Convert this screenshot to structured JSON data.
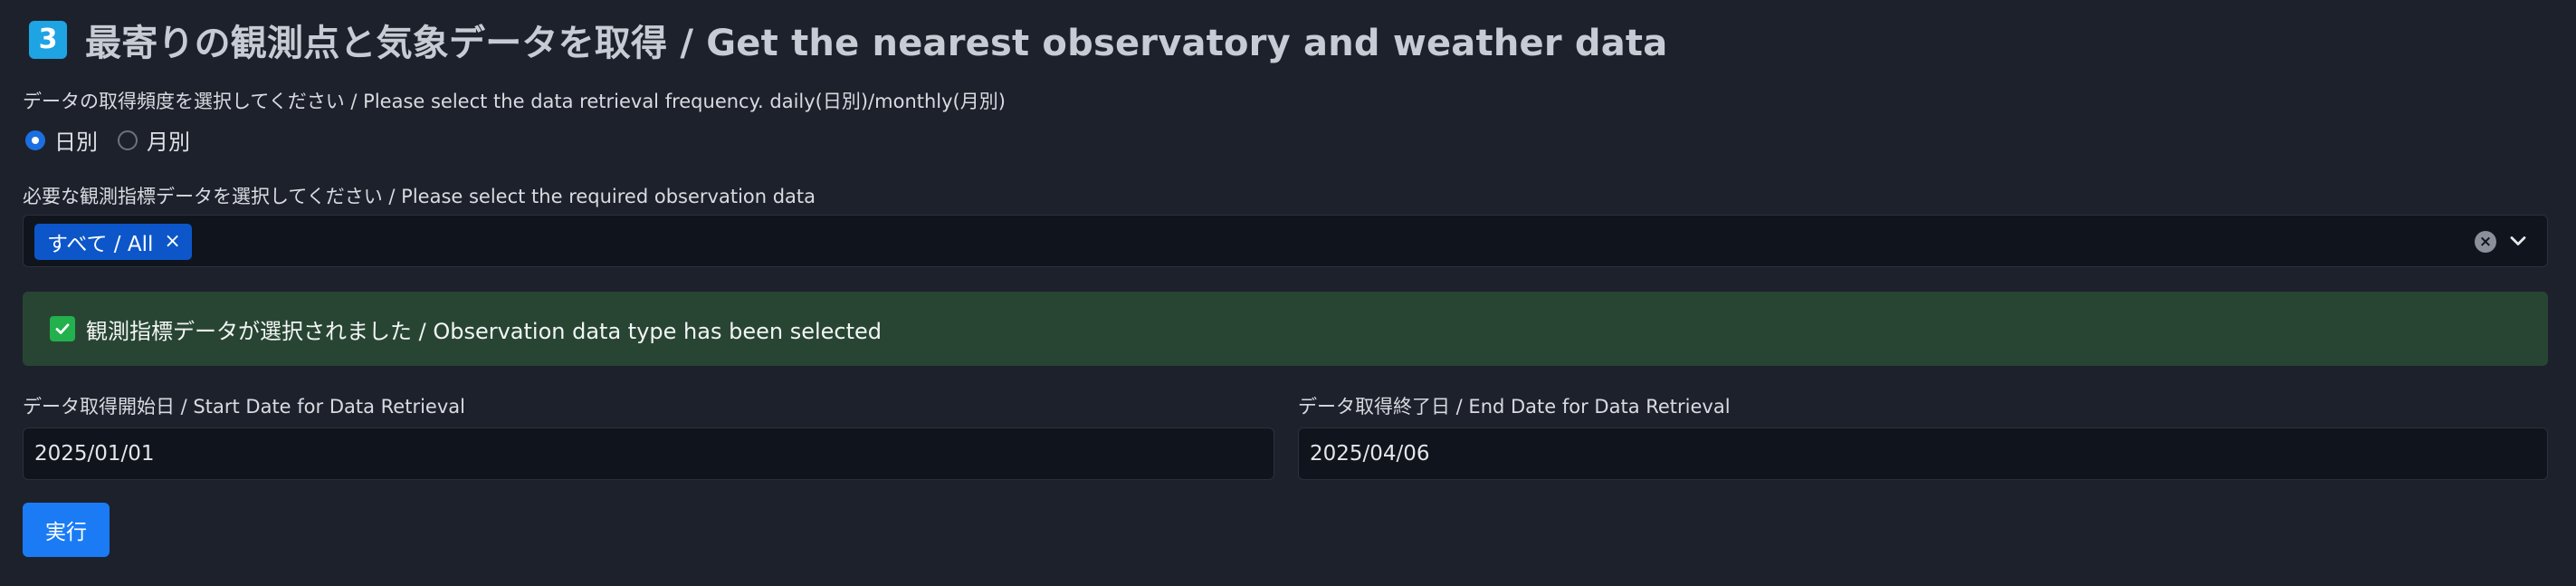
{
  "header": {
    "step_number": "3",
    "title": "最寄りの観測点と気象データを取得 / Get the nearest observatory and weather data"
  },
  "frequency": {
    "label": "データの取得頻度を選択してください / Please select the data retrieval frequency. daily(日別)/monthly(月別)",
    "options": [
      {
        "label": "日別",
        "checked": true
      },
      {
        "label": "月別",
        "checked": false
      }
    ]
  },
  "observation": {
    "label": "必要な観測指標データを選択してください / Please select the required observation data",
    "selected_chips": [
      {
        "label": "すべて / All"
      }
    ],
    "chip_remove_symbol": "×",
    "clear_symbol": "×"
  },
  "alert": {
    "text": "観測指標データが選択されました / Observation data type has been selected",
    "color": "#284534"
  },
  "start_date": {
    "label": "データ取得開始日 / Start Date for Data Retrieval",
    "value": "2025/01/01"
  },
  "end_date": {
    "label": "データ取得終了日 / End Date for Data Retrieval",
    "value": "2025/04/06"
  },
  "run_button": {
    "label": "実行",
    "color": "#1a7bf5"
  },
  "icons": {
    "step": "step-number-icon",
    "check": "check-icon",
    "clear": "clear-icon",
    "chevron": "chevron-down-icon"
  }
}
